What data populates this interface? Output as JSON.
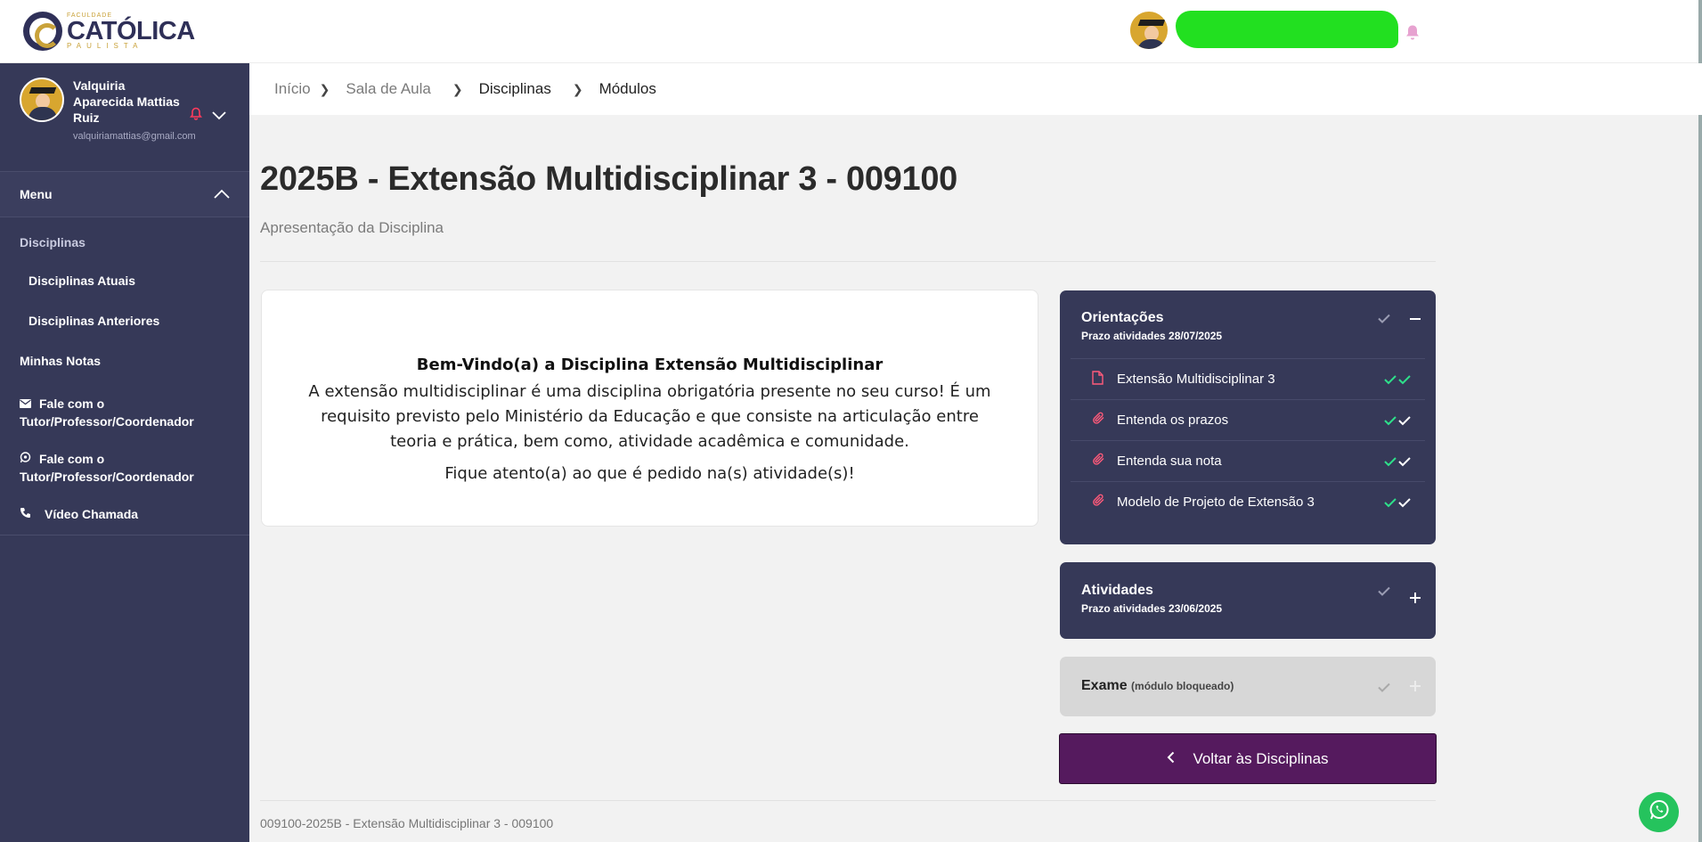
{
  "brand": {
    "logo_small": "FACULDADE",
    "logo_main": "CATÓLICA",
    "logo_sub": "PAULISTA",
    "primary_color": "#363958",
    "accent_color": "#551a5e"
  },
  "user": {
    "name": "Valquiria Aparecida Mattias Ruiz",
    "email": "valquiriamattias@gmail.com"
  },
  "sidebar": {
    "menu_label": "Menu",
    "section_label": "Disciplinas",
    "items": [
      {
        "label": "Disciplinas Atuais",
        "icon": "none"
      },
      {
        "label": "Disciplinas Anteriores",
        "icon": "none"
      },
      {
        "label": "Minhas Notas",
        "icon": "none"
      },
      {
        "label": "Fale com o Tutor/Professor/Coordenador",
        "icon": "envelope-icon"
      },
      {
        "label": "Fale com o Tutor/Professor/Coordenador",
        "icon": "whatsapp-icon"
      },
      {
        "label": "Vídeo Chamada",
        "icon": "phone-icon"
      }
    ]
  },
  "breadcrumb": [
    "Início",
    "Sala de Aula",
    "Disciplinas",
    "Módulos"
  ],
  "page": {
    "title": "2025B - Extensão Multidisciplinar 3 - 009100",
    "subtitle": "Apresentação da Disciplina"
  },
  "welcome": {
    "heading": "Bem-Vindo(a) a Disciplina Extensão Multidisciplinar",
    "body": "A extensão multidisciplinar é uma disciplina obrigatória presente no seu curso! É um requisito previsto pelo Ministério da Educação e que consiste na articulação entre teoria e prática, bem como, atividade acadêmica e comunidade.",
    "note": "Fique atento(a) ao que é pedido na(s) atividade(s)!"
  },
  "modules": {
    "orientacoes": {
      "title": "Orientações",
      "due": "Prazo atividades 28/07/2025",
      "items": [
        {
          "label": "Extensão Multidisciplinar 3",
          "icon": "file-icon"
        },
        {
          "label": "Entenda os prazos",
          "icon": "paperclip-icon"
        },
        {
          "label": "Entenda sua nota",
          "icon": "paperclip-icon"
        },
        {
          "label": "Modelo de Projeto de Extensão 3",
          "icon": "paperclip-icon"
        }
      ]
    },
    "atividades": {
      "title": "Atividades",
      "due": "Prazo atividades 23/06/2025"
    },
    "exame": {
      "title": "Exame",
      "status": "(módulo bloqueado)"
    }
  },
  "back_button_label": "Voltar às Disciplinas",
  "footer": "009100-2025B - Extensão Multidisciplinar 3 - 009100"
}
